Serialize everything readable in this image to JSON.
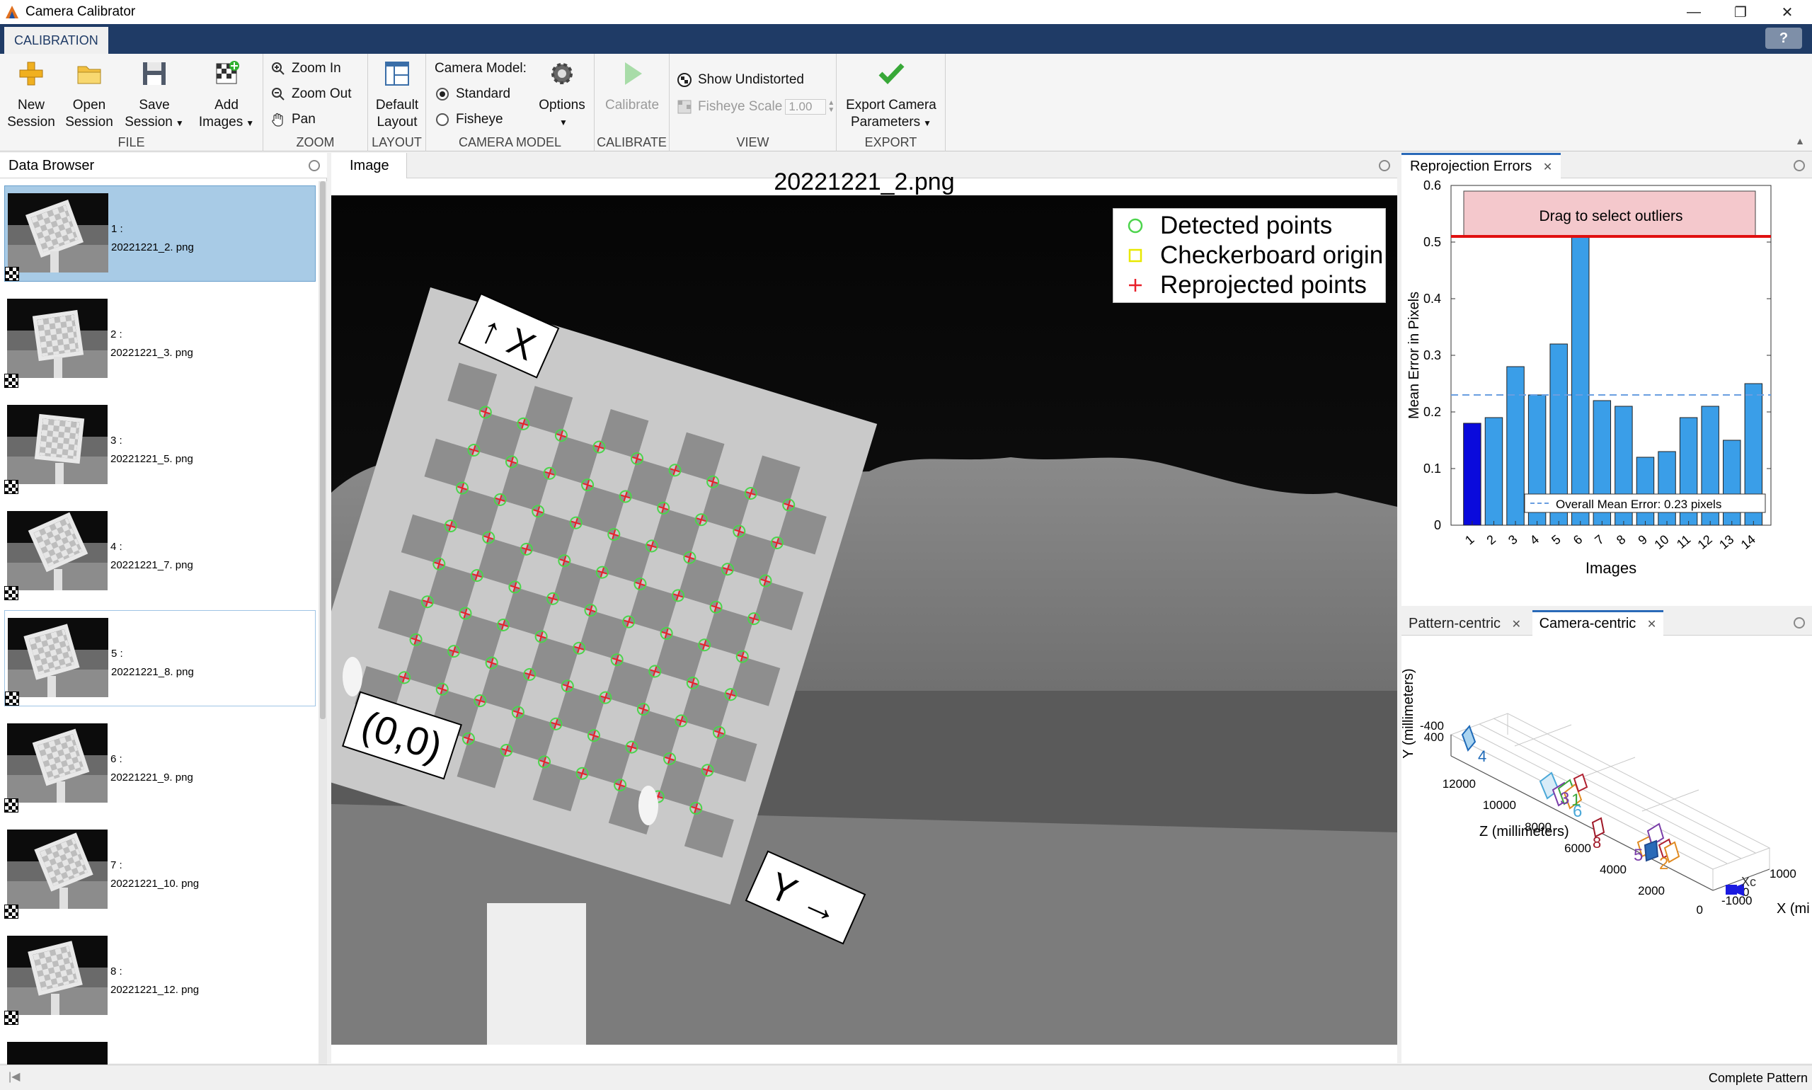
{
  "window": {
    "title": "Camera Calibrator",
    "minimize": "—",
    "maximize": "❐",
    "close": "✕"
  },
  "tab": {
    "label": "CALIBRATION"
  },
  "help": "?",
  "ribbon": {
    "file": {
      "label": "FILE",
      "new": [
        "New",
        "Session"
      ],
      "open": [
        "Open",
        "Session"
      ],
      "save": [
        "Save",
        "Session"
      ],
      "add": [
        "Add",
        "Images"
      ]
    },
    "zoom": {
      "label": "ZOOM",
      "zoom_in": "Zoom In",
      "zoom_out": "Zoom Out",
      "pan": "Pan"
    },
    "layout": {
      "label": "LAYOUT",
      "default": [
        "Default",
        "Layout"
      ]
    },
    "camera_model": {
      "label": "CAMERA MODEL",
      "title": "Camera Model:",
      "standard": "Standard",
      "fisheye": "Fisheye",
      "options": "Options"
    },
    "calibrate": {
      "label": "CALIBRATE",
      "button": "Calibrate"
    },
    "view": {
      "label": "VIEW",
      "show_undistorted": "Show Undistorted",
      "fisheye_scale": "Fisheye Scale",
      "fisheye_scale_value": "1.00"
    },
    "export": {
      "label": "EXPORT",
      "button": [
        "Export Camera",
        "Parameters"
      ]
    }
  },
  "browser": {
    "title": "Data Browser",
    "items": [
      {
        "index": "1 :",
        "name": "20221221_2. png"
      },
      {
        "index": "2 :",
        "name": "20221221_3. png"
      },
      {
        "index": "3 :",
        "name": "20221221_5. png"
      },
      {
        "index": "4 :",
        "name": "20221221_7. png"
      },
      {
        "index": "5 :",
        "name": "20221221_8. png"
      },
      {
        "index": "6 :",
        "name": "20221221_9. png"
      },
      {
        "index": "7 :",
        "name": "20221221_10. png"
      },
      {
        "index": "8 :",
        "name": "20221221_12. png"
      }
    ]
  },
  "image_panel": {
    "tab": "Image",
    "image_title": "20221221_2.png",
    "legend": {
      "detected": "Detected points",
      "origin": "Checkerboard origin",
      "reprojected": "Reprojected points"
    },
    "labels": {
      "x": "↑ X",
      "y": "Y →",
      "origin": "(0,0)"
    },
    "colors": {
      "detected": "#4cd44c",
      "origin": "#e8e800",
      "reprojected": "#e8202a"
    }
  },
  "reprojection": {
    "tab": "Reprojection Errors",
    "outlier_label": "Drag to select outliers",
    "mean_legend": "Overall Mean Error: 0.23 pixels"
  },
  "chart_data": {
    "type": "bar",
    "categories": [
      "1",
      "2",
      "3",
      "4",
      "5",
      "6",
      "7",
      "8",
      "9",
      "10",
      "11",
      "12",
      "13",
      "14"
    ],
    "values": [
      0.18,
      0.19,
      0.28,
      0.23,
      0.32,
      0.51,
      0.22,
      0.21,
      0.12,
      0.13,
      0.19,
      0.21,
      0.15,
      0.25
    ],
    "mean": 0.23,
    "threshold": 0.51,
    "xlabel": "Images",
    "ylabel": "Mean Error in Pixels",
    "ylim": [
      0,
      0.6
    ],
    "yticks": [
      "0",
      "0.1",
      "0.2",
      "0.3",
      "0.4",
      "0.5",
      "0.6"
    ],
    "selected_index": 0,
    "colors": {
      "bar": "#3a9ee8",
      "selected": "#0a0adc",
      "threshold": "#e01010",
      "mean": "#6a9ee0"
    }
  },
  "extrinsics": {
    "tabs": [
      "Pattern-centric",
      "Camera-centric"
    ],
    "y_label": "Y (millimeters)",
    "z_label": "Z (millimeters)",
    "x_label": "X (mi",
    "y_ticks": [
      "-400",
      "400"
    ],
    "z_ticks": [
      "12000",
      "10000",
      "8000",
      "6000",
      "4000",
      "2000",
      "0"
    ],
    "x_ticks": [
      "-1000",
      "0",
      "1000"
    ],
    "board_labels": [
      "4",
      "3",
      "1",
      "6",
      "8",
      "5",
      "2"
    ],
    "camera_label": "Xc"
  },
  "status": {
    "text": "Complete Pattern"
  }
}
